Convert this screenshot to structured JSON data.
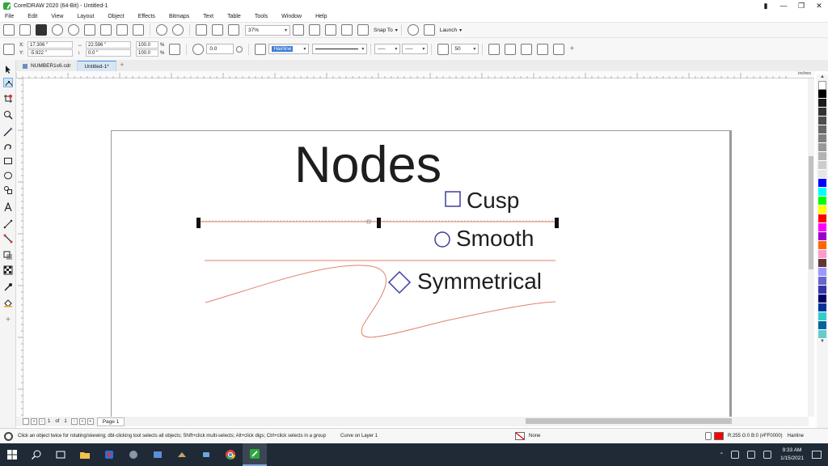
{
  "window": {
    "title": "CorelDRAW 2020 (64-Bit) - Untitled-1"
  },
  "menu": [
    "File",
    "Edit",
    "View",
    "Layout",
    "Object",
    "Effects",
    "Bitmaps",
    "Text",
    "Table",
    "Tools",
    "Window",
    "Help"
  ],
  "standard_toolbar": {
    "zoom": "37%",
    "snap_to": "Snap To",
    "launch": "Launch"
  },
  "property_bar": {
    "x": "17.306 \"",
    "y": "-5.922 \"",
    "w": "22.596 \"",
    "h": "0.0 \"",
    "scale_w": "100.0",
    "scale_h": "100.0",
    "percent": "%",
    "rotation": "0.0",
    "outline_width": "Hairline",
    "smoothing": "50"
  },
  "doc_tabs": [
    "NUMBER1x6.cdr",
    "Untitled-1*"
  ],
  "ruler_unit": "inches",
  "canvas": {
    "heading": "Nodes",
    "cusp": "Cusp",
    "smooth": "Smooth",
    "symmetrical": "Symmetrical"
  },
  "palette": [
    "#ffffff",
    "#000000",
    "#1a1a1a",
    "#333333",
    "#4d4d4d",
    "#666666",
    "#808080",
    "#999999",
    "#b3b3b3",
    "#cccccc",
    "#e6e6e6",
    "#0000ff",
    "#00ffff",
    "#00ff00",
    "#ffff00",
    "#ff0000",
    "#ff00ff",
    "#9900cc",
    "#ff6600",
    "#ff99cc",
    "#663333",
    "#9999ff",
    "#6666cc",
    "#3333aa",
    "#000066",
    "#003399",
    "#33cccc",
    "#006699",
    "#66cccc"
  ],
  "page_nav": {
    "current": "1",
    "of": "of",
    "total": "1",
    "page_tab": "Page 1"
  },
  "status": {
    "hint": "Click an object twice for rotating/skewing; dbl-clicking tool selects all objects; Shift+click multi-selects; Alt+click digs; Ctrl+click selects in a group",
    "object": "Curve on Layer 1",
    "fill": "None",
    "stroke_color": "R:255 G:0 B:0 (#FF0000)",
    "stroke_width": "Hairline"
  },
  "taskbar": {
    "time": "9:33 AM",
    "date": "1/15/2021"
  },
  "colors": {
    "curve": "#e0826a",
    "node_outline": "#3e3e9e"
  }
}
